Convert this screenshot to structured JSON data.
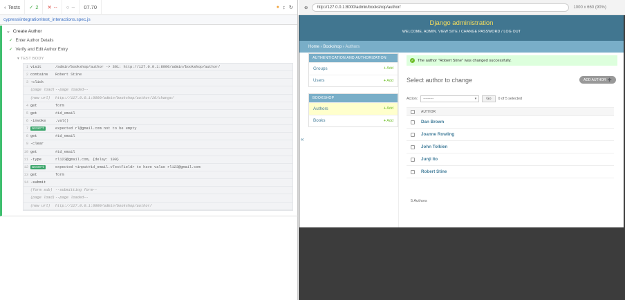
{
  "runner": {
    "tests_label": "Tests",
    "passed": "2",
    "failed": "--",
    "pending": "--",
    "duration": "07.70",
    "spec_path": "cypress\\integration\\test_interactions.spec.js"
  },
  "reporter": {
    "suite": "Create Author",
    "tests": [
      "Enter Author Details",
      "Verify and Edit Author Entry"
    ],
    "body_label": "TEST BODY",
    "commands": [
      {
        "num": "1",
        "name": "visit",
        "msg": "/admin/bookshop/author -> 301: http://127.0.0.1:8000/admin/bookshop/author/",
        "type": "cmd"
      },
      {
        "num": "2",
        "name": "contains",
        "msg": "Robert Stine",
        "type": "cmd"
      },
      {
        "num": "3",
        "name": "-click",
        "msg": "",
        "type": "cmd"
      },
      {
        "num": "",
        "name": "(page load)",
        "msg": "--page loaded--",
        "type": "ev"
      },
      {
        "num": "",
        "name": "(new url)",
        "msg": "http://127.0.0.1:8000/admin/bookshop/author/20/change/",
        "type": "ev"
      },
      {
        "num": "4",
        "name": "get",
        "msg": "form",
        "type": "cmd"
      },
      {
        "num": "5",
        "name": "get",
        "msg": "#id_email",
        "type": "cmd"
      },
      {
        "num": "6",
        "name": "-invoke",
        "msg": ".val()",
        "type": "cmd"
      },
      {
        "num": "7",
        "name": "assert",
        "msg": "expected rl@gmail.com not to be empty",
        "type": "assert",
        "strong": "rl@gmail.com"
      },
      {
        "num": "8",
        "name": "get",
        "msg": "#id_email",
        "type": "cmd"
      },
      {
        "num": "9",
        "name": "-clear",
        "msg": "",
        "type": "cmd"
      },
      {
        "num": "10",
        "name": "get",
        "msg": "#id_email",
        "type": "cmd"
      },
      {
        "num": "11",
        "name": "-type",
        "msg": "rl123@gmail.com, {delay: 100}",
        "type": "cmd"
      },
      {
        "num": "12",
        "name": "assert",
        "msg": "expected <input#id_email.vTextField> to have value rl123@gmail.com",
        "type": "assert",
        "strong": "rl123@gmail.com"
      },
      {
        "num": "13",
        "name": "get",
        "msg": "form",
        "type": "cmd"
      },
      {
        "num": "14",
        "name": "-submit",
        "msg": "",
        "type": "cmd"
      },
      {
        "num": "",
        "name": "(form sub)",
        "msg": "--submitting form--",
        "type": "ev"
      },
      {
        "num": "",
        "name": "(page load)",
        "msg": "--page loaded--",
        "type": "ev"
      },
      {
        "num": "",
        "name": "(new url)",
        "msg": "http://127.0.0.1:8000/admin/bookshop/author/",
        "type": "ev"
      }
    ]
  },
  "browser": {
    "url": "http://127.0.0.1:8000/admin/bookshop/author/",
    "viewport_info": "1000 x 660 (90%)"
  },
  "django": {
    "site_title": "Django administration",
    "user_tools": "WELCOME, ADMIN. VIEW SITE / CHANGE PASSWORD / LOG OUT",
    "breadcrumb_home": "Home",
    "breadcrumb_app": "Bookshop",
    "breadcrumb_current": "Authors",
    "modules": [
      {
        "caption": "AUTHENTICATION AND AUTHORIZATION",
        "rows": [
          "Groups",
          "Users"
        ]
      },
      {
        "caption": "BOOKSHOP",
        "rows": [
          "Authors",
          "Books"
        ]
      }
    ],
    "add_label": "Add",
    "success_message": "The author \"Robert Stine\" was changed successfully.",
    "page_title": "Select author to change",
    "add_author_button": "ADD AUTHOR",
    "action_label": "Action:",
    "action_select": "---------",
    "go_button": "Go",
    "selected_count": "0 of 5 selected",
    "column_header": "AUTHOR",
    "authors": [
      "Dan Brown",
      "Joanne Rowling",
      "John Tolkien",
      "Junji Ito",
      "Robert Stine"
    ],
    "total": "5 Authors"
  }
}
